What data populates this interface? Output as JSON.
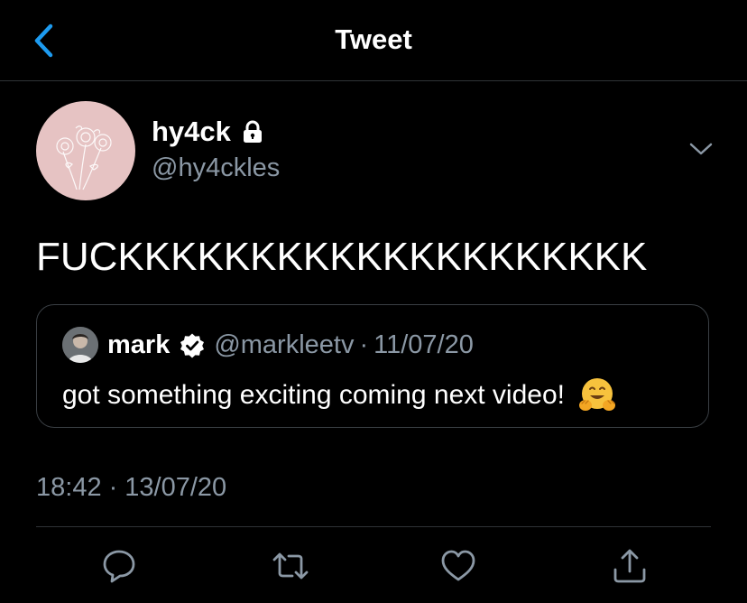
{
  "header": {
    "title": "Tweet",
    "back_icon": "chevron-left-icon"
  },
  "tweet": {
    "author": {
      "name": "hy4ck",
      "handle": "@hy4ckles",
      "protected_icon": "lock-icon"
    },
    "text": "FUCKKKKKKKKKKKKKKKKKKKK",
    "timestamp": {
      "time": "18:42",
      "separator": "·",
      "date": "13/07/20"
    },
    "menu_icon": "chevron-down-icon"
  },
  "quoted_tweet": {
    "name": "mark",
    "verified_icon": "verified-badge-icon",
    "handle": "@markleetv",
    "separator": "·",
    "date": "11/07/20",
    "text": "got something exciting coming next video!",
    "emoji_icon": "hugging-face-emoji-icon"
  },
  "actions": [
    "reply-icon",
    "retweet-icon",
    "like-icon",
    "share-icon"
  ],
  "colors": {
    "background": "#000000",
    "accent": "#1d9bf0",
    "muted_text": "#8b98a5",
    "divider": "#2f3336",
    "avatar_bg": "#e6c3c3"
  }
}
